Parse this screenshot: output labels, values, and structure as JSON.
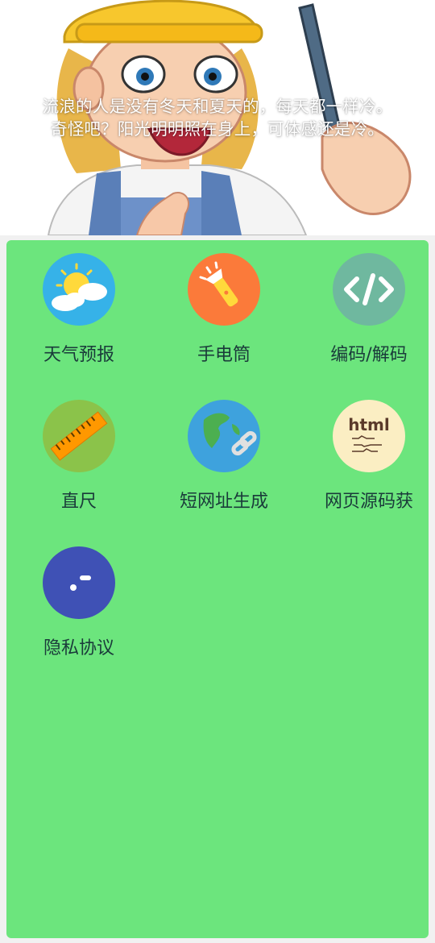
{
  "header": {
    "quote_line1": "流浪的人是没有冬天和夏天的，每天都一样冷。",
    "quote_line2": "奇怪吧？阳光明明照在身上，可体感还是冷。"
  },
  "tools": [
    {
      "label": "天气预报",
      "icon": "weather-icon",
      "color": "#36b2e8"
    },
    {
      "label": "手电筒",
      "icon": "flashlight-icon",
      "color": "#fb7a3a"
    },
    {
      "label": "编码/解码",
      "icon": "code-icon",
      "color": "#6fb89f"
    },
    {
      "label": "直尺",
      "icon": "ruler-icon",
      "color": "#8bc34a"
    },
    {
      "label": "短网址生成",
      "icon": "globe-link-icon",
      "color": "#3ea2dd"
    },
    {
      "label": "网页源码获",
      "icon": "html-source-icon",
      "color": "#fbeec3"
    },
    {
      "label": "隐私协议",
      "icon": "privacy-icon",
      "color": "#3f51b5"
    }
  ],
  "colors": {
    "panel": "#6ce57d",
    "label_text": "#1a3b3a"
  }
}
